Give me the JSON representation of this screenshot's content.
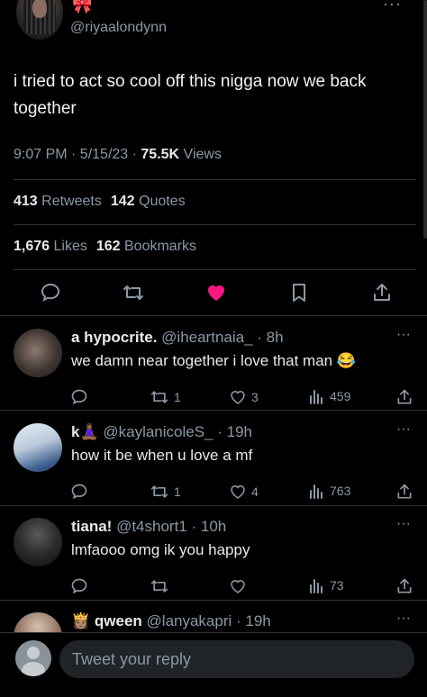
{
  "main_tweet": {
    "handle": "@riyaalondynn",
    "text": "i tried to act so cool off this nigga now we back together",
    "time": "9:07 PM · 5/15/23 · ",
    "views_count": "75.5K",
    "views_label": " Views",
    "retweets_count": "413",
    "retweets_label": " Retweets",
    "quotes_count": "142",
    "quotes_label": " Quotes",
    "likes_count": "1,676",
    "likes_label": " Likes",
    "bookmarks_count": "162",
    "bookmarks_label": " Bookmarks",
    "liked": true
  },
  "replies": [
    {
      "name": "a hypocrite.",
      "handle": "@iheartnaia_",
      "time": "· 8h",
      "text": "we damn near together i love that man 😂",
      "retweets": "1",
      "likes": "3",
      "views": "459"
    },
    {
      "name": "k🧘🏾‍♀️",
      "handle": "@kaylanicoleS_",
      "time": "· 19h",
      "text": "how it be when u love a mf",
      "retweets": "1",
      "likes": "4",
      "views": "763"
    },
    {
      "name": "tiana!",
      "handle": "@t4short1",
      "time": "· 10h",
      "text": "lmfaooo omg ik you happy",
      "retweets": "",
      "likes": "",
      "views": "73"
    },
    {
      "name": "👸🏽 qween",
      "handle": "@lanyakapri",
      "time": "· 19h",
      "text": "",
      "retweets": "",
      "likes": "",
      "views": ""
    }
  ],
  "composer": {
    "placeholder": "Tweet your reply"
  },
  "colors": {
    "like_active": "#f91880",
    "muted": "#8b98a5",
    "background": "#000000"
  }
}
